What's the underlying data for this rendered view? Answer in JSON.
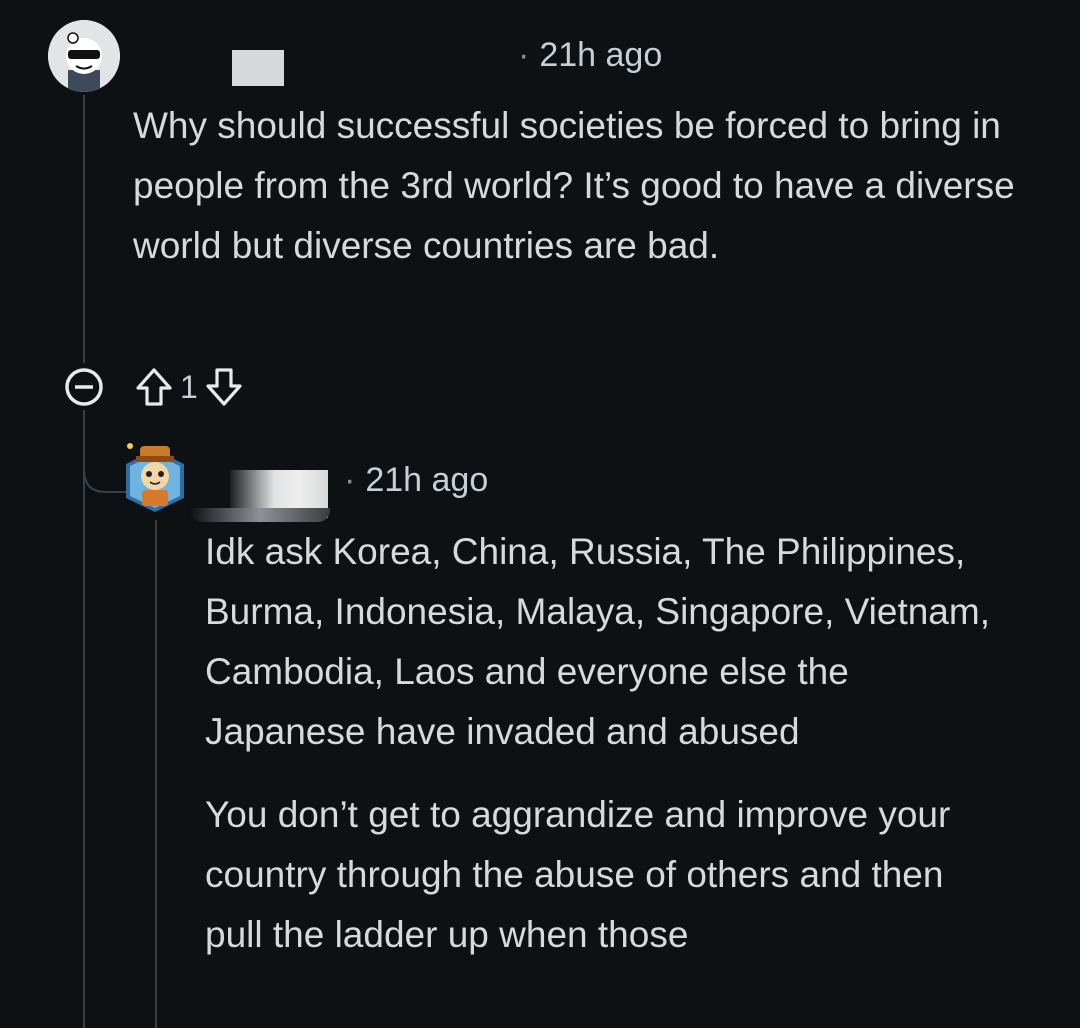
{
  "comments": [
    {
      "timestamp": "21h ago",
      "paragraphs": [
        "Why should successful societies be forced to bring in people from the 3rd world? It’s good to have a diverse world but diverse countries are bad."
      ],
      "score": "1",
      "avatar_icon": "user-avatar-sunglasses-icon"
    },
    {
      "timestamp": "21h ago",
      "paragraphs": [
        "Idk ask Korea, China, Russia, The Philippines, Burma, Indonesia, Malaya, Singapore, Vietnam, Cambodia, Laos and everyone else the Japanese have invaded and abused",
        "You don’t get to aggrandize and improve your country through the abuse of others and then pull the ladder up when those"
      ],
      "avatar_icon": "user-avatar-fox-hat-icon"
    }
  ],
  "icons": {
    "collapse": "collapse-minus-icon",
    "upvote": "upvote-arrow-icon",
    "downvote": "downvote-arrow-icon"
  },
  "colors": {
    "background": "#0e1114",
    "text": "#d7dadc",
    "thread_line": "#3a3f44"
  }
}
